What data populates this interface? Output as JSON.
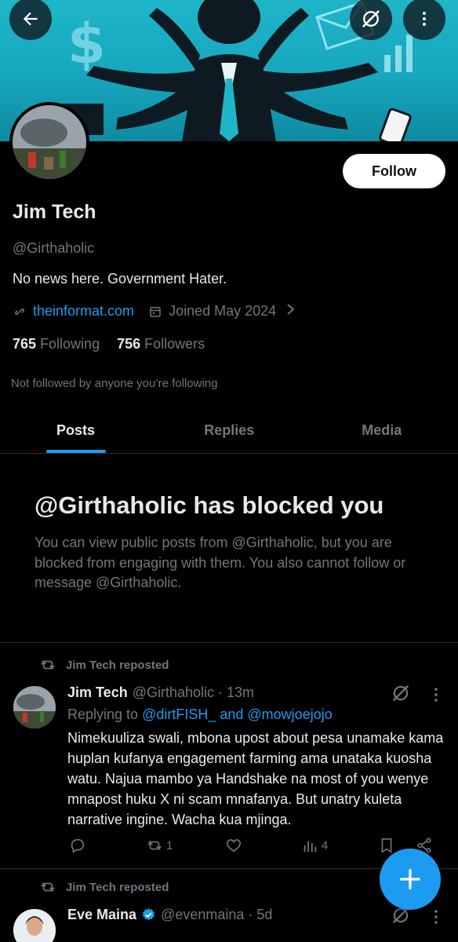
{
  "header": {
    "back_icon": "arrow-left-icon",
    "grok_icon": "grok-icon",
    "more_icon": "more-vertical-icon"
  },
  "profile": {
    "name": "Jim Tech",
    "handle": "@Girthaholic",
    "bio": "No news here.  Government Hater.",
    "website": "theinformat.com",
    "joined": "Joined May 2024",
    "following_count": "765",
    "following_label": "Following",
    "followers_count": "756",
    "followers_label": "Followers",
    "mutuals_note": "Not followed by anyone you’re following",
    "follow_label": "Follow"
  },
  "tabs": [
    {
      "label": "Posts",
      "active": true
    },
    {
      "label": "Replies",
      "active": false
    },
    {
      "label": "Media",
      "active": false
    }
  ],
  "blocked": {
    "title": "@Girthaholic has blocked you",
    "description": "You can view public posts from @Girthaholic, but you are blocked from engaging with them. You also cannot follow or message @Girthaholic."
  },
  "posts": [
    {
      "repost_label": "Jim Tech reposted",
      "author_name": "Jim Tech",
      "author_handle": "@Girthaholic",
      "time": "· 13m",
      "replying_prefix": "Replying to",
      "replying_handles": "@dirtFISH_ and @mowjoejojo",
      "text": "Nimekuuliza swali, mbona upost about pesa unamake kama huplan kufanya engagement farming ama unataka kuosha watu. Najua mambo ya Handshake na most of you wenye mnapost huku X ni scam mnafanya. But unatry kuleta narrative ingine. Wacha kua mjinga.",
      "reposts": "1",
      "views": "4"
    },
    {
      "repost_label": "Jim Tech reposted",
      "author_name": "Eve Maina",
      "author_handle": "@evenmaina",
      "time": "· 5d",
      "verified": true
    }
  ],
  "fab": {
    "icon": "plus-icon"
  },
  "colors": {
    "accent": "#1d9bf0",
    "background": "#000000",
    "text_primary": "#e7e9ea",
    "text_secondary": "#71767b",
    "divider": "#2f3336"
  }
}
